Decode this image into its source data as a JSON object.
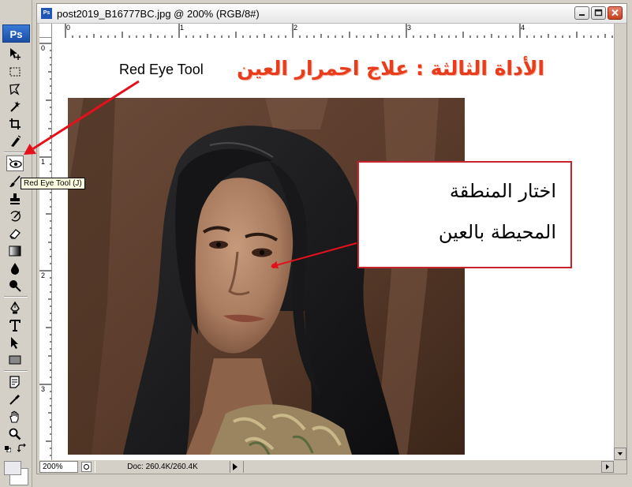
{
  "app": {
    "logo_text": "Ps"
  },
  "window": {
    "title": "post2019_B16777BC.jpg @ 200% (RGB/8#)",
    "icon_text": "Ps"
  },
  "toolbox": {
    "tools": [
      {
        "name": "move-tool",
        "icon": "move-icon"
      },
      {
        "name": "marquee-tool",
        "icon": "marquee-icon"
      },
      {
        "name": "lasso-tool",
        "icon": "lasso-icon"
      },
      {
        "name": "magic-wand-tool",
        "icon": "magic-wand-icon"
      },
      {
        "name": "crop-tool",
        "icon": "crop-icon"
      },
      {
        "name": "slice-tool",
        "icon": "slice-icon"
      },
      {
        "name": "red-eye-tool",
        "icon": "red-eye-icon",
        "active": true
      },
      {
        "name": "brush-tool",
        "icon": "brush-icon"
      },
      {
        "name": "stamp-tool",
        "icon": "stamp-icon"
      },
      {
        "name": "history-brush-tool",
        "icon": "history-brush-icon"
      },
      {
        "name": "eraser-tool",
        "icon": "eraser-icon"
      },
      {
        "name": "gradient-tool",
        "icon": "gradient-icon"
      },
      {
        "name": "blur-tool",
        "icon": "blur-icon"
      },
      {
        "name": "dodge-tool",
        "icon": "dodge-icon"
      },
      {
        "name": "pen-tool",
        "icon": "pen-icon"
      },
      {
        "name": "type-tool",
        "icon": "type-icon"
      },
      {
        "name": "path-selection-tool",
        "icon": "path-selection-icon"
      },
      {
        "name": "shape-tool",
        "icon": "rectangle-icon"
      },
      {
        "name": "notes-tool",
        "icon": "notes-icon"
      },
      {
        "name": "eyedropper-tool",
        "icon": "eyedropper-icon"
      },
      {
        "name": "hand-tool",
        "icon": "hand-icon"
      },
      {
        "name": "zoom-tool",
        "icon": "zoom-icon"
      }
    ],
    "tooltip": "Red Eye Tool (J)",
    "foreground_color": "#e9e9ee",
    "background_color": "#ffffff"
  },
  "rulers": {
    "top_labels": [
      "0",
      "1",
      "2",
      "3",
      "4"
    ],
    "left_labels": [
      "0",
      "1",
      "2",
      "3"
    ]
  },
  "canvas": {
    "caption_en": "Red Eye Tool",
    "title_ar": "الأداة الثالثة : علاج احمرار العين",
    "callout_lines": [
      "اختار المنطقة",
      "المحيطة بالعين"
    ],
    "accent_color": "#e83c1c",
    "arrow_color": "#e4101c",
    "callout_border_color": "#c8232d"
  },
  "status": {
    "zoom": "200%",
    "doc_info": "Doc: 260.4K/260.4K"
  }
}
